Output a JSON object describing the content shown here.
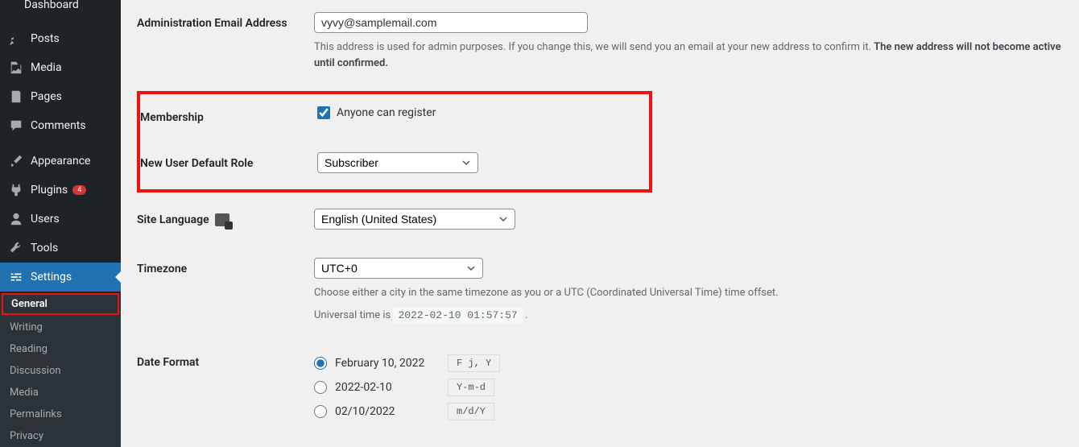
{
  "sidebar": {
    "dashboard": "Dashboard",
    "posts": "Posts",
    "media": "Media",
    "pages": "Pages",
    "comments": "Comments",
    "appearance": "Appearance",
    "plugins": "Plugins",
    "plugins_badge": "4",
    "users": "Users",
    "tools": "Tools",
    "settings": "Settings",
    "submenu": {
      "general": "General",
      "writing": "Writing",
      "reading": "Reading",
      "discussion": "Discussion",
      "media": "Media",
      "permalinks": "Permalinks",
      "privacy": "Privacy"
    }
  },
  "form": {
    "admin_email_label": "Administration Email Address",
    "admin_email_value": "vyvy@samplemail.com",
    "admin_email_desc_a": "This address is used for admin purposes. If you change this, we will send you an email at your new address to confirm it. ",
    "admin_email_desc_b": "The new address will not become active until confirmed.",
    "membership_label": "Membership",
    "membership_checkbox": "Anyone can register",
    "default_role_label": "New User Default Role",
    "default_role_value": "Subscriber",
    "site_language_label": "Site Language",
    "site_language_value": "English (United States)",
    "timezone_label": "Timezone",
    "timezone_value": "UTC+0",
    "timezone_desc": "Choose either a city in the same timezone as you or a UTC (Coordinated Universal Time) time offset.",
    "universal_time_label": "Universal time is ",
    "universal_time_value": "2022-02-10 01:57:57",
    "date_format_label": "Date Format",
    "date_formats": [
      {
        "label": "February 10, 2022",
        "code": "F j, Y",
        "checked": true
      },
      {
        "label": "2022-02-10",
        "code": "Y-m-d",
        "checked": false
      },
      {
        "label": "02/10/2022",
        "code": "m/d/Y",
        "checked": false
      }
    ]
  }
}
